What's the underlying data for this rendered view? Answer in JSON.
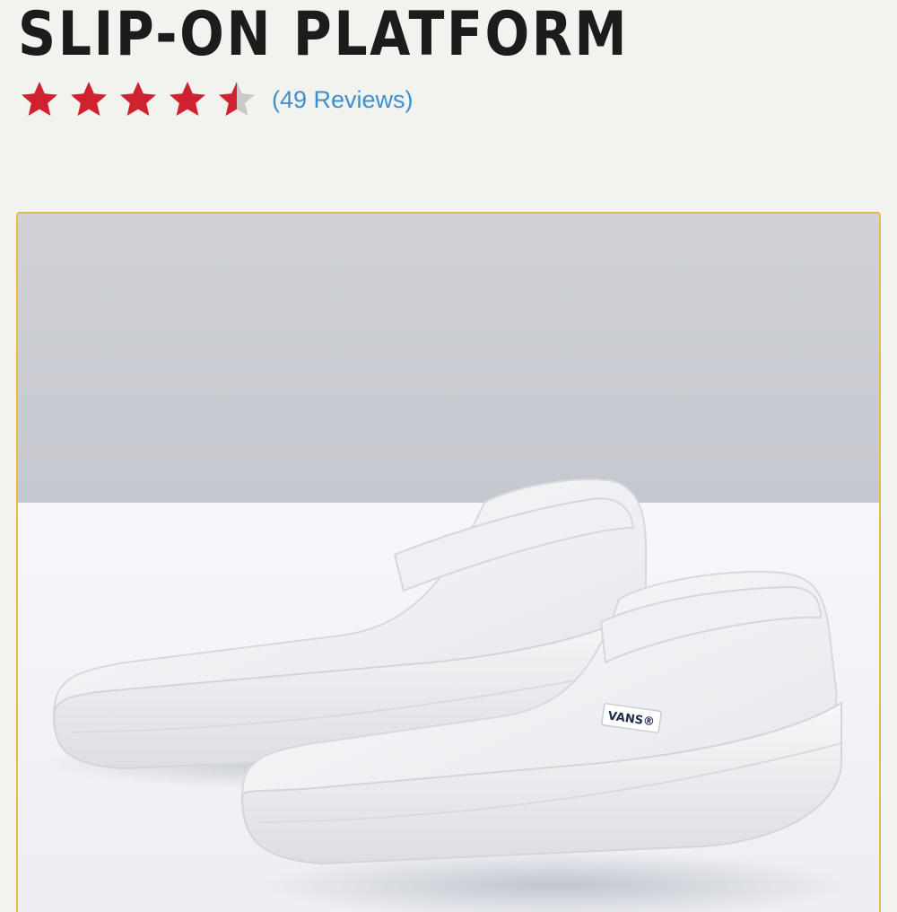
{
  "product": {
    "title": "SLIP-ON PLATFORM",
    "rating": 4.5,
    "rating_max": 5,
    "reviews_label": "(49 Reviews)",
    "brand_tag": "VANS®"
  },
  "colors": {
    "star_filled": "#d0222e",
    "star_empty": "#c9c9c9",
    "link": "#3f8fcf",
    "image_border": "#e9b94a"
  },
  "icons": {
    "star": "star-icon"
  }
}
